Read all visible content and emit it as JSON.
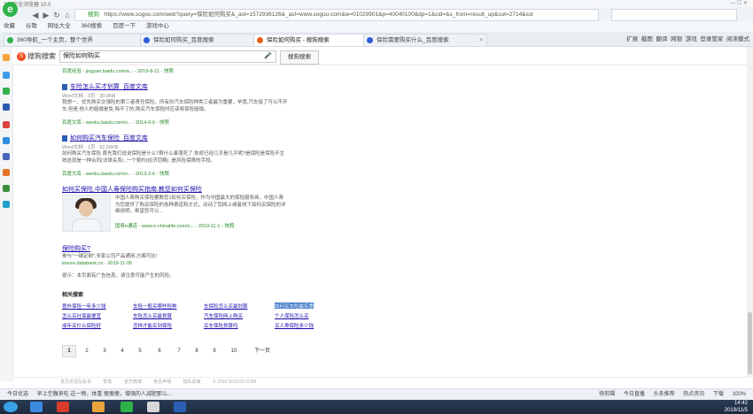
{
  "browser": {
    "title": "360安全浏览器 10.0",
    "url": "https://www.sogou.com/web?query=保险如何购买&_ast=1572936126&_asf=www.sogou.com&w=01029901&p=40040100&dp=1&cid=&s_from=result_up&sut=2714&sst",
    "url_label": "搜狗",
    "bookmarks": [
      "收藏",
      "谷歌",
      "网址大全",
      "360搜索",
      "百度一下",
      "游戏中心"
    ],
    "tabs": [
      {
        "label": "360导航_一个主页，整个世界"
      },
      {
        "label": "保险如何购买_百度搜索"
      },
      {
        "label": "保险如何购买 - 搜狗搜索"
      },
      {
        "label": "保险需要购买什么_百度搜索"
      }
    ],
    "tab_tools": [
      "扩展",
      "截图",
      "翻译",
      "网银",
      "游戏",
      "登录管家",
      "阅读模式"
    ]
  },
  "search": {
    "logo_text": "搜狗搜索",
    "query": "保险如何购买",
    "button": "搜狗搜索",
    "truncated_source": "百度经验 - jingyan.baidu.com/a... - 2019-8-11 - 快照"
  },
  "results": [
    {
      "title": "车险怎么买才划算_百度文库",
      "meta": "Word文档 · 3页 · 30.0KB",
      "snippet": "我想一、优先购买交强险的第三者责任保险，所有的汽车保险种类三者最为重要，毕竟,汽车投了可以不开车,但是,他人的赔偿是免,除不了的,购买汽车保险时应该将保险赔偿。",
      "source": "百度文库 - wenku.baidu.com/v... - 2014-9-6 - 快照"
    },
    {
      "title": "如何购买汽车保险_百度文库",
      "meta": "Word文档 · 1页 · 52.50KB",
      "snippet": "如何购买汽车保险 首先我们说说保险是什么?首什么事落死了,你却已经几乎是几乎呢?是保险是保险不生效这就是一种合同(法律关系) ,一个契约(经济范畴) ,是风险保障的手段。",
      "source": "百度文库 - wenku.baidu.com/v... - 2013-2-6 - 快照"
    },
    {
      "title": "如何买保险,中国人寿保险购买指南,教您如何买保险",
      "snippet": "中国人寿购买保险要教您1如何买保险，作为中国最大的保险服务商，中国人寿为您提供了购买保险的各种渠道和方式，动动了您网上或者线下如何买保险的详细说明，希望您可以...",
      "source": "国寿e通道 - www.e-chinalife.com/s... - 2019-11-1 - 快照"
    },
    {
      "title": "保险购买?",
      "snippet": "参与\"一键定制\",多家公司产品通用,方案可比!",
      "source": "insure.databank.cn - 2019-11-05",
      "tip": "提示：本页面有广告信息，请注意可能产生的风险。"
    }
  ],
  "related": {
    "title": "相关搜索",
    "items": [
      "意外保险一年多少钱",
      "车险一般买哪些险种",
      "车保险怎么买最划算",
      "如何买车险最实惠",
      "怎么买社保最便宜",
      "车险怎么买最划算",
      "汽车保险网上购买",
      "个人保险怎么买",
      "成年买什么保险好",
      "怎样才能买到保险",
      "买车保险划算吗",
      "买人寿保险多少钱"
    ]
  },
  "pager": {
    "pages": [
      "1",
      "2",
      "3",
      "4",
      "5",
      "6",
      "7",
      "8",
      "9",
      "10"
    ],
    "next": "下一页",
    "current": "1"
  },
  "footer": [
    "意见反馈及投诉",
    "帮助",
    "官方微博",
    "免责声明",
    "隐私政策",
    "© 2019 SOGOU.COM"
  ],
  "status": {
    "left": [
      "今日优选",
      "早上空腹来吃 这一物，体重 瘦瘦瘦，增强的人减肥那么..."
    ],
    "right": [
      "快剪辑",
      "今日直播",
      "头条推荐",
      "热点资讯",
      "下载",
      "100%"
    ]
  },
  "taskbar": {
    "time": "14:42",
    "date": "2019/11/5"
  },
  "colors": {
    "link": "#1a0dab",
    "highlight": "#d23b2a",
    "source": "#2a8a2a",
    "selected_related": "#3f78c8"
  }
}
